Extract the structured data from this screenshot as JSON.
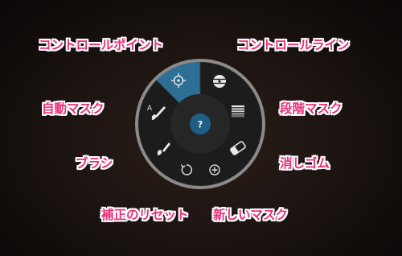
{
  "labels": {
    "control_point": "コントロールポイント",
    "control_line": "コントロールライン",
    "auto_mask": "自動マスク",
    "gradient_mask": "段階マスク",
    "brush": "ブラシ",
    "eraser": "消しゴム",
    "reset_correction": "補正のリセット",
    "new_mask": "新しいマスク"
  },
  "wheel": {
    "center_label": "?",
    "auto_mask_letter": "A"
  },
  "colors": {
    "label_text": "#ea2f78",
    "label_outline": "#ffffff",
    "wheel_ring": "#8c8a88",
    "wheel_outer": "#1c1c1c",
    "wheel_inner": "#262626",
    "active_segment": "#2e6f96",
    "center_button": "#1f5e85"
  },
  "icons": {
    "control_point": "crosshair-icon",
    "control_line": "control-line-icon",
    "auto_mask": "auto-mask-brush-icon",
    "gradient_mask": "gradient-mask-icon",
    "brush": "brush-icon",
    "eraser": "eraser-icon",
    "reset": "reset-icon",
    "new_mask": "plus-circle-icon",
    "help": "help-icon"
  },
  "state": {
    "active_tool": "control_point"
  }
}
